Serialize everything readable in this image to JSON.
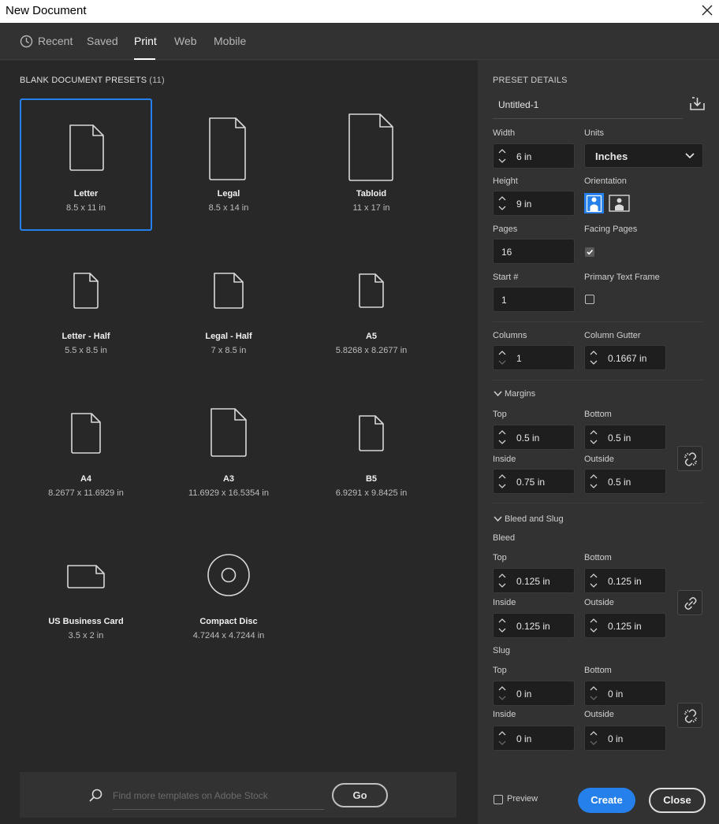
{
  "window": {
    "title": "New Document"
  },
  "tabs": [
    {
      "label": "Recent",
      "icon": "clock-icon"
    },
    {
      "label": "Saved"
    },
    {
      "label": "Print",
      "active": true
    },
    {
      "label": "Web"
    },
    {
      "label": "Mobile"
    }
  ],
  "presets": {
    "header": "BLANK DOCUMENT PRESETS",
    "count": "(11)",
    "items": [
      {
        "name": "Letter",
        "size": "8.5 x 11 in",
        "icon": "page-portrait-icon",
        "selected": true
      },
      {
        "name": "Legal",
        "size": "8.5 x 14 in",
        "icon": "page-portrait-icon"
      },
      {
        "name": "Tabloid",
        "size": "11 x 17 in",
        "icon": "page-portrait-icon"
      },
      {
        "name": "Letter - Half",
        "size": "5.5 x 8.5 in",
        "icon": "page-portrait-icon"
      },
      {
        "name": "Legal - Half",
        "size": "7 x 8.5 in",
        "icon": "page-portrait-icon"
      },
      {
        "name": "A5",
        "size": "5.8268 x 8.2677 in",
        "icon": "page-portrait-icon"
      },
      {
        "name": "A4",
        "size": "8.2677 x 11.6929 in",
        "icon": "page-portrait-icon"
      },
      {
        "name": "A3",
        "size": "11.6929 x 16.5354 in",
        "icon": "page-portrait-icon"
      },
      {
        "name": "B5",
        "size": "6.9291 x 9.8425 in",
        "icon": "page-portrait-icon"
      },
      {
        "name": "US Business Card",
        "size": "3.5 x 2 in",
        "icon": "page-landscape-icon"
      },
      {
        "name": "Compact Disc",
        "size": "4.7244 x 4.7244 in",
        "icon": "disc-icon"
      }
    ]
  },
  "stock": {
    "placeholder": "Find more templates on Adobe Stock",
    "go_label": "Go"
  },
  "details": {
    "header": "PRESET DETAILS",
    "doc_name": "Untitled-1",
    "width_label": "Width",
    "width": "6 in",
    "units_label": "Units",
    "units": "Inches",
    "height_label": "Height",
    "height": "9 in",
    "orientation_label": "Orientation",
    "orientation": "portrait",
    "pages_label": "Pages",
    "pages": "16",
    "facing_label": "Facing Pages",
    "facing_checked": true,
    "start_label": "Start #",
    "start": "1",
    "primary_label": "Primary Text Frame",
    "primary_checked": false,
    "columns_label": "Columns",
    "columns": "1",
    "gutter_label": "Column Gutter",
    "gutter": "0.1667 in",
    "margins": {
      "title": "Margins",
      "top_label": "Top",
      "top": "0.5 in",
      "bottom_label": "Bottom",
      "bottom": "0.5 in",
      "inside_label": "Inside",
      "inside": "0.75 in",
      "outside_label": "Outside",
      "outside": "0.5 in",
      "linked": false
    },
    "bleed_slug": {
      "title": "Bleed and Slug",
      "bleed_label": "Bleed",
      "bleed": {
        "top": "0.125 in",
        "bottom": "0.125 in",
        "inside": "0.125 in",
        "outside": "0.125 in",
        "linked": true
      },
      "slug_label": "Slug",
      "slug": {
        "top": "0 in",
        "bottom": "0 in",
        "inside": "0 in",
        "outside": "0 in",
        "linked": false
      },
      "top_label": "Top",
      "bottom_label": "Bottom",
      "inside_label": "Inside",
      "outside_label": "Outside"
    },
    "preview_label": "Preview",
    "preview_checked": false,
    "create_label": "Create",
    "close_label": "Close"
  },
  "colors": {
    "accent": "#2680eb",
    "panel": "#323232",
    "well": "#282828"
  }
}
